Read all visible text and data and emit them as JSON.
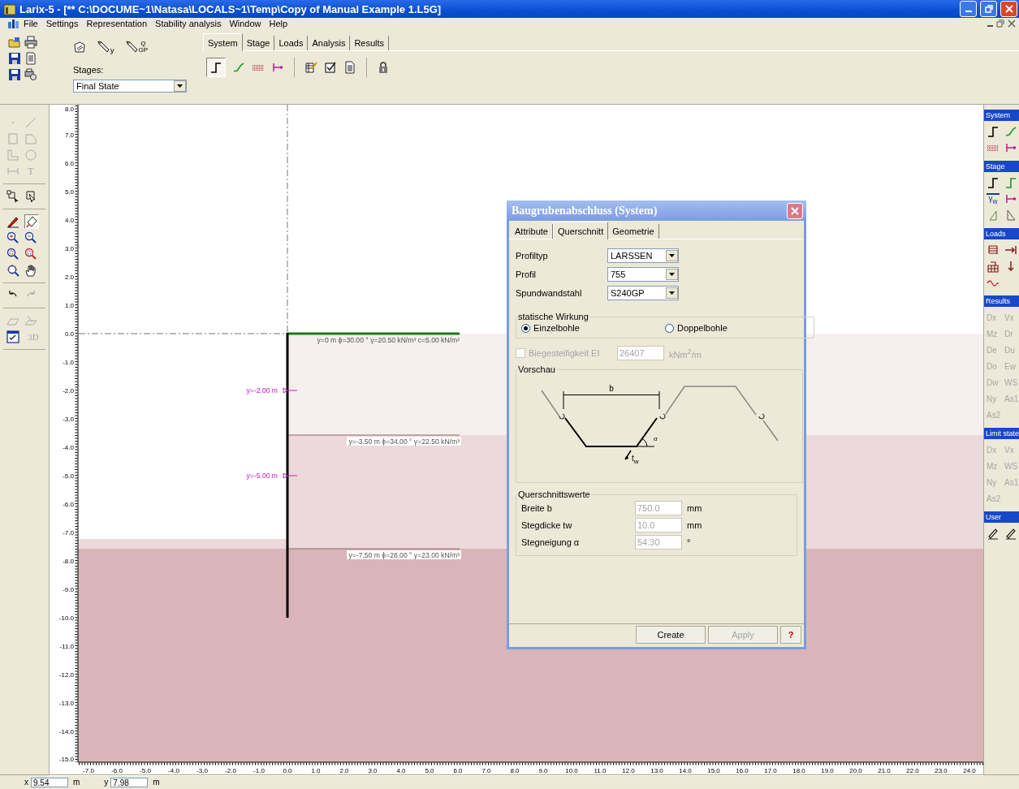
{
  "window": {
    "title": "Larix-5 - [** C:\\DOCUME~1\\Natasa\\LOCALS~1\\Temp\\Copy of Manual Example 1.L5G]"
  },
  "menu": [
    "File",
    "Settings",
    "Representation",
    "Stability analysis",
    "Window",
    "Help"
  ],
  "toolbar": {
    "stage_tool_marks": [
      "y",
      "Q",
      "GP"
    ],
    "stages_label": "Stages:",
    "stage_value": "Final State",
    "tabs": [
      {
        "label": "System",
        "selected": true
      },
      {
        "label": "Stage",
        "selected": false
      },
      {
        "label": "Loads",
        "selected": false
      },
      {
        "label": "Analysis",
        "selected": false
      },
      {
        "label": "Results",
        "selected": false
      }
    ]
  },
  "left_palette": {
    "text_tool": {
      "label": "T",
      "disabled": true
    },
    "view_3d": {
      "label": "3D",
      "disabled": true
    }
  },
  "canvas": {
    "y_axis_labels": [
      "8.0",
      "7.0",
      "6.0",
      "5.0",
      "4.0",
      "3.0",
      "2.0",
      "1.0",
      "0.0",
      "-1.0",
      "-2.0",
      "-3.0",
      "-4.0",
      "-5.0",
      "-6.0",
      "-7.0",
      "-8.0",
      "-9.0",
      "-10.0",
      "-11.0",
      "-12.0",
      "-13.0",
      "-14.0",
      "-15.0"
    ],
    "x_axis_labels": [
      "-7.0",
      "-6.0",
      "-5.0",
      "-4.0",
      "-3.0",
      "-2.0",
      "-1.0",
      "0.0",
      "1.0",
      "2.0",
      "3.0",
      "4.0",
      "5.0",
      "6.0",
      "7.0",
      "8.0",
      "9.0",
      "10.0",
      "11.0",
      "12.0",
      "13.0",
      "14.0",
      "15.0",
      "16.0",
      "17.0",
      "18.0",
      "19.0",
      "20.0",
      "21.0",
      "22.0",
      "23.0",
      "24.0"
    ],
    "layers": [
      {
        "label": "y=0 m ϕ=30.00 ° γ=20.50 kN/m³ c=5.00 kN/m²",
        "color": "#f7eeee"
      },
      {
        "label": "y=-3.50 m ϕ=34.00 ° γ=22.50 kN/m³",
        "color": "#ecd9db"
      },
      {
        "label": "y=-7.50 m ϕ=28.00 ° γ=23.00 kN/m³",
        "color": "#d9b5b9"
      }
    ],
    "anchors": [
      {
        "label": "y=-2.00 m"
      },
      {
        "label": "y=-5.00 m"
      }
    ]
  },
  "right_palette": {
    "sections": [
      {
        "title": "System",
        "kind": "icons"
      },
      {
        "title": "Stage",
        "kind": "icons",
        "water_symbol": "γ",
        "water_sub": "w"
      },
      {
        "title": "Loads",
        "kind": "icons"
      },
      {
        "title": "Results",
        "kind": "labels",
        "items": [
          {
            "label": "Dx",
            "disabled": true
          },
          {
            "label": "Vx",
            "disabled": true
          },
          {
            "label": "Mz",
            "disabled": true
          },
          {
            "label": "Dr",
            "disabled": true
          },
          {
            "label": "De",
            "disabled": true
          },
          {
            "label": "Du",
            "disabled": true
          },
          {
            "label": "Do",
            "disabled": true
          },
          {
            "label": "Ew",
            "disabled": true
          },
          {
            "label": "Dw",
            "disabled": true
          },
          {
            "label": "WS",
            "disabled": true
          },
          {
            "label": "Ny",
            "disabled": true
          },
          {
            "label": "As1",
            "disabled": true
          },
          {
            "label": "As2",
            "disabled": true
          }
        ]
      },
      {
        "title": "Limit state",
        "kind": "labels",
        "items": [
          {
            "label": "Dx",
            "disabled": true
          },
          {
            "label": "Vx",
            "disabled": true
          },
          {
            "label": "Mz",
            "disabled": true
          },
          {
            "label": "WS",
            "disabled": true
          },
          {
            "label": "Ny",
            "disabled": true
          },
          {
            "label": "As1",
            "disabled": true
          },
          {
            "label": "As2",
            "disabled": true
          }
        ]
      },
      {
        "title": "User",
        "kind": "icons"
      }
    ]
  },
  "dialog": {
    "title": "Baugrubenabschluss (System)",
    "tabs": [
      {
        "label": "Attribute",
        "selected": false
      },
      {
        "label": "Querschnitt",
        "selected": true
      },
      {
        "label": "Geometrie",
        "selected": false
      }
    ],
    "selects": [
      {
        "label": "Profiltyp",
        "value": "LARSSEN"
      },
      {
        "label": "Profil",
        "value": "755"
      },
      {
        "label": "Spundwandstahl",
        "value": "S240GP"
      }
    ],
    "action_group": {
      "title": "statische Wirkung",
      "options": [
        {
          "label": "Einzelbohle",
          "selected": true
        },
        {
          "label": "Doppelbohle",
          "selected": false
        }
      ]
    },
    "stiffness": {
      "label": "Biegesteifigkeit EI",
      "checked": false,
      "disabled": true,
      "value": "26407",
      "unit": "kNm$^{2}$/m"
    },
    "preview": {
      "title": "Vorschau",
      "width_label": "b",
      "angle_label": "α",
      "thickness_label": "t",
      "thickness_sub": "w"
    },
    "values": {
      "title": "Querschnittswerte",
      "rows": [
        {
          "label": "Breite b",
          "value": "750.0",
          "unit": "mm",
          "disabled": true
        },
        {
          "label": "Stegdicke tw",
          "value": "10.0",
          "unit": "mm",
          "disabled": true
        },
        {
          "label": "Stegneigung α",
          "value": "54.30",
          "unit": "°",
          "disabled": true
        }
      ]
    },
    "buttons": [
      {
        "label": "Create",
        "disabled": false
      },
      {
        "label": "Apply",
        "disabled": true
      },
      {
        "label": "?",
        "disabled": false
      }
    ]
  },
  "status_bar": {
    "x_label": "x",
    "x_value": "9.54",
    "x_unit": "m",
    "y_label": "y",
    "y_value": "7.98",
    "y_unit": "m"
  }
}
